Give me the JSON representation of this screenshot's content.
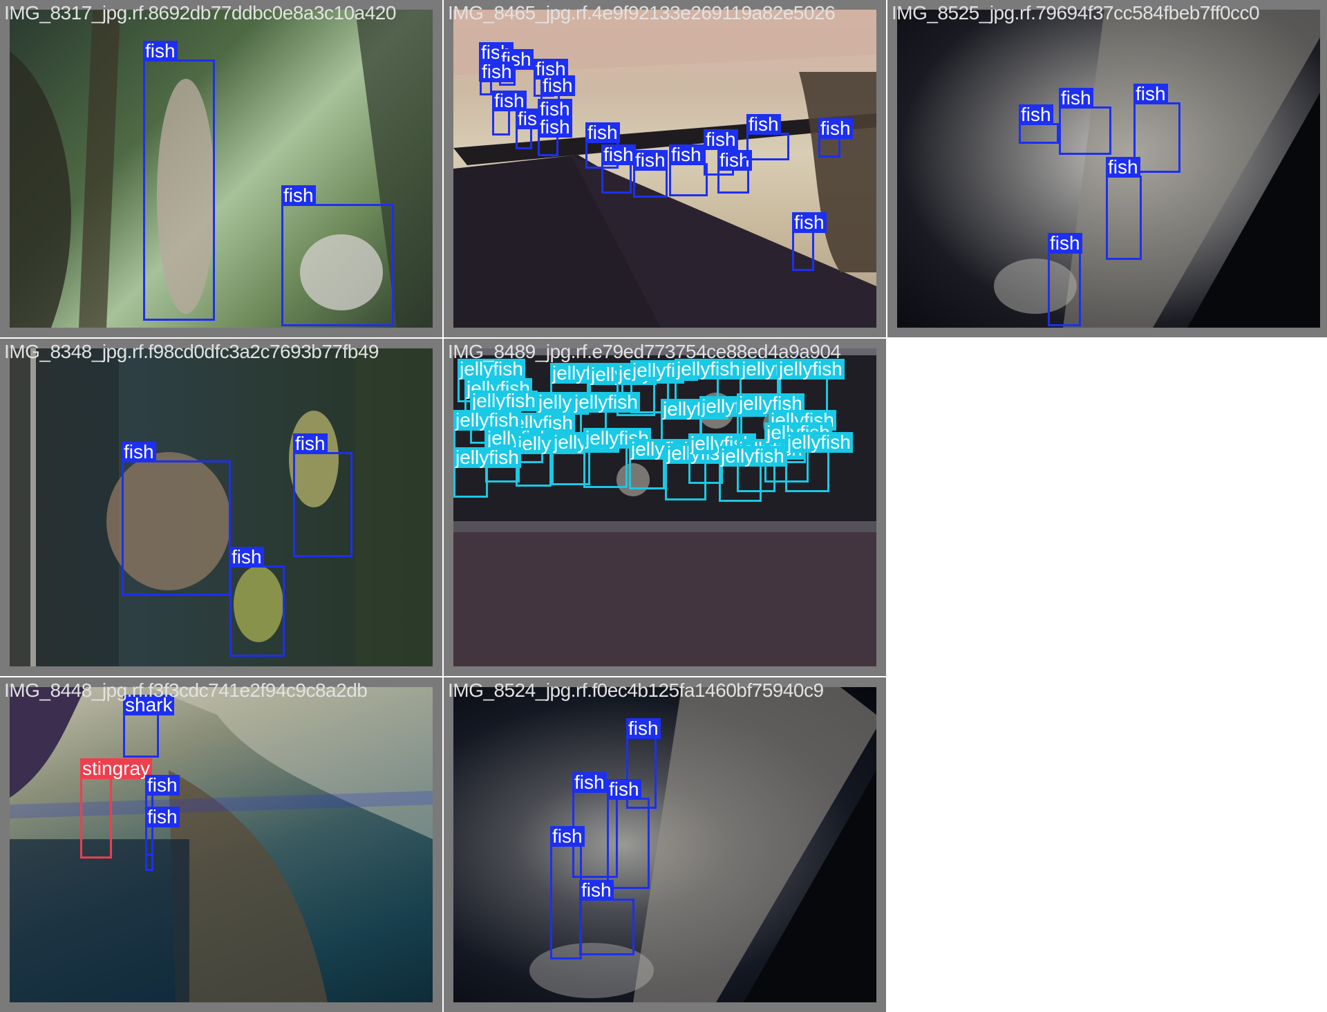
{
  "colors": {
    "fish": "#1d2ff0",
    "jellyfish": "#19c9e6",
    "stingray": "#ef3e4e",
    "tile_border": "#7a7a7a",
    "title": "#e2e2e2"
  },
  "tiles": [
    {
      "title": "IMG_8317_jpg.rf.8692db77ddbc0e8a3c10a420",
      "boxes": [
        {
          "label": "fish"
        },
        {
          "label": "fish"
        }
      ]
    },
    {
      "title": "IMG_8465_jpg.rf.4e9f92133e269119a82e5026",
      "boxes": [
        {
          "label": "fish"
        },
        {
          "label": "fish"
        },
        {
          "label": "fish"
        },
        {
          "label": "fish"
        },
        {
          "label": "fish"
        },
        {
          "label": "fish"
        },
        {
          "label": "fish"
        },
        {
          "label": "fish"
        },
        {
          "label": "fish"
        },
        {
          "label": "fish"
        },
        {
          "label": "fish"
        },
        {
          "label": "fish"
        },
        {
          "label": "fish"
        },
        {
          "label": "fish"
        },
        {
          "label": "fish"
        },
        {
          "label": "fish"
        },
        {
          "label": "fish"
        },
        {
          "label": "fish"
        }
      ]
    },
    {
      "title": "IMG_8525_jpg.rf.79694f37cc584fbeb7ff0cc0",
      "boxes": [
        {
          "label": "fish"
        },
        {
          "label": "fish"
        },
        {
          "label": "fish"
        },
        {
          "label": "fish"
        },
        {
          "label": "fish"
        }
      ]
    },
    {
      "title": "IMG_8348_jpg.rf.f98cd0dfc3a2c7693b77fb49",
      "boxes": [
        {
          "label": "fish"
        },
        {
          "label": "fish"
        },
        {
          "label": "fish"
        }
      ]
    },
    {
      "title": "IMG_8489_jpg.rf.e79ed773754ce88ed4a9a904",
      "boxes": [
        {
          "label": "jellyfish"
        },
        {
          "label": "jellyfish"
        },
        {
          "label": "jellyfish"
        },
        {
          "label": "jellyfish"
        },
        {
          "label": "jellyfish"
        },
        {
          "label": "jellyfish"
        },
        {
          "label": "jellyfish"
        },
        {
          "label": "jellyfish"
        },
        {
          "label": "jellyfish"
        },
        {
          "label": "jellyfish"
        },
        {
          "label": "jellyfish"
        },
        {
          "label": "jellyfish"
        },
        {
          "label": "jellyfish"
        },
        {
          "label": "jellyfish"
        },
        {
          "label": "jellyfish"
        },
        {
          "label": "jellyfish"
        },
        {
          "label": "jellyfish"
        },
        {
          "label": "jellyfish"
        },
        {
          "label": "jellyfish"
        },
        {
          "label": "jellyfish"
        },
        {
          "label": "jellyfish"
        },
        {
          "label": "jellyfish"
        },
        {
          "label": "jellyfish"
        },
        {
          "label": "jellyfish"
        },
        {
          "label": "jellyfish"
        },
        {
          "label": "jellyfish"
        },
        {
          "label": "jellyfish"
        },
        {
          "label": "jellyfish"
        },
        {
          "label": "jellyfish"
        },
        {
          "label": "jellyfish"
        }
      ]
    },
    {
      "title": "IMG_8448_jpg.rf.f3f3cdc741e2f94c9c8a2db",
      "boxes": [
        {
          "label": "shark"
        },
        {
          "label": "stingray"
        },
        {
          "label": "fish"
        },
        {
          "label": "fish"
        }
      ]
    },
    {
      "title": "IMG_8524_jpg.rf.f0ec4b125fa1460bf75940c9",
      "boxes": [
        {
          "label": "fish"
        },
        {
          "label": "fish"
        },
        {
          "label": "fish"
        },
        {
          "label": "fish"
        },
        {
          "label": "fish"
        }
      ]
    }
  ]
}
